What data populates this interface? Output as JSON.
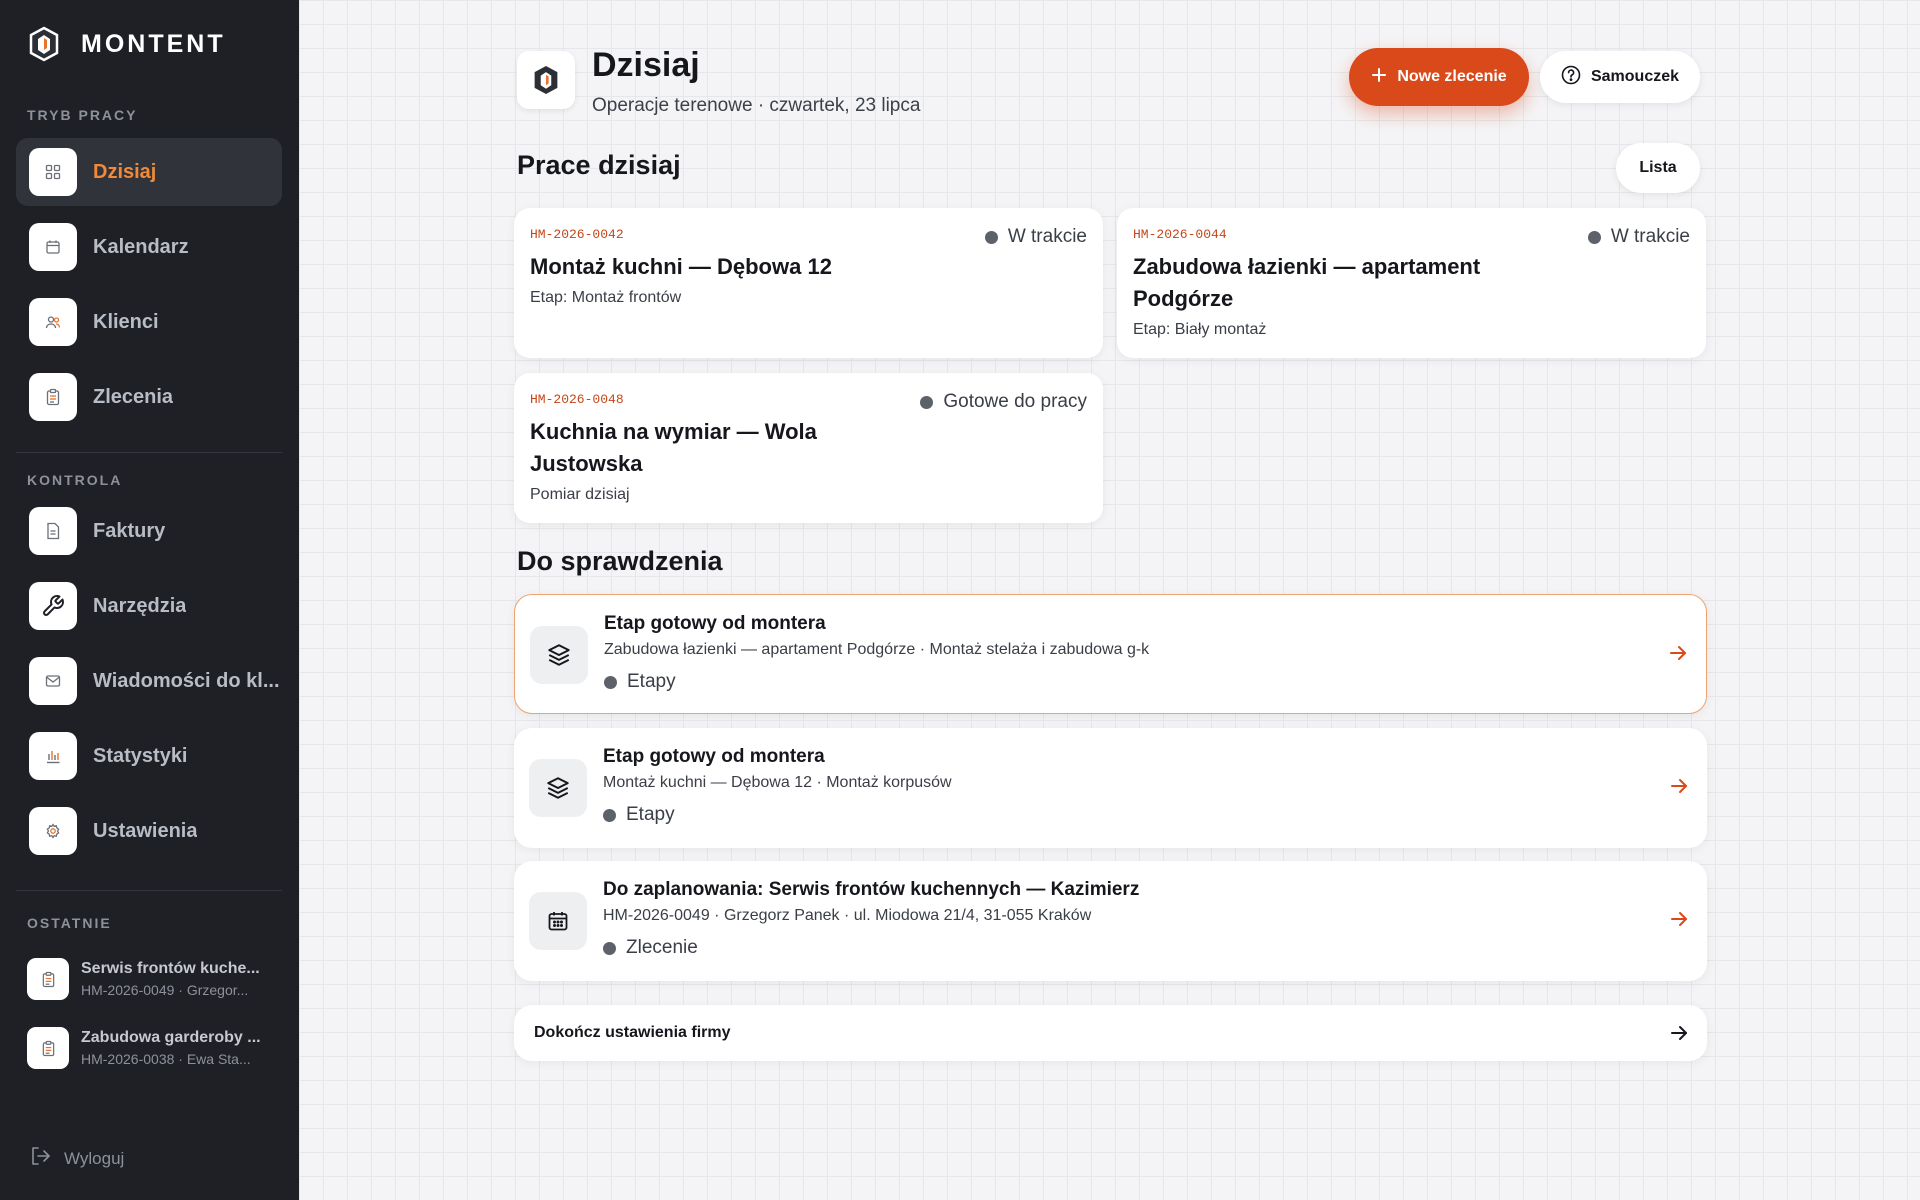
{
  "brand": {
    "name": "MONTENT"
  },
  "sidebar": {
    "sections": {
      "work": "TRYB PRACY",
      "control": "KONTROLA",
      "recent": "OSTATNIE"
    },
    "work_items": [
      {
        "label": "Dzisiaj",
        "icon": "grid-icon",
        "active": true
      },
      {
        "label": "Kalendarz",
        "icon": "calendar-icon"
      },
      {
        "label": "Klienci",
        "icon": "users-icon"
      },
      {
        "label": "Zlecenia",
        "icon": "clipboard-icon"
      }
    ],
    "control_items": [
      {
        "label": "Faktury",
        "icon": "document-icon"
      },
      {
        "label": "Narzędzia",
        "icon": "wrench-icon"
      },
      {
        "label": "Wiadomości do kl...",
        "icon": "mail-icon"
      },
      {
        "label": "Statystyki",
        "icon": "bar-chart-icon"
      },
      {
        "label": "Ustawienia",
        "icon": "gear-icon"
      }
    ],
    "recent_items": [
      {
        "title": "Serwis frontów kuche...",
        "sub": "HM-2026-0049 · Grzegor..."
      },
      {
        "title": "Zabudowa garderoby ...",
        "sub": "HM-2026-0038 · Ewa Sta..."
      }
    ],
    "logout": "Wyloguj"
  },
  "header": {
    "title": "Dzisiaj",
    "subtitle": "Operacje terenowe · czwartek, 23 lipca",
    "primary_button": "Nowe zlecenie",
    "secondary_button": "Samouczek"
  },
  "today": {
    "title": "Prace dzisiaj",
    "view_button": "Lista",
    "jobs": [
      {
        "code": "HM-2026-0042",
        "status": "W trakcie",
        "title": "Montaż kuchni — Dębowa 12",
        "stage": "Etap: Montaż frontów"
      },
      {
        "code": "HM-2026-0044",
        "status": "W trakcie",
        "title": "Zabudowa łazienki — apartament Podgórze",
        "stage": "Etap: Biały montaż"
      },
      {
        "code": "HM-2026-0048",
        "status": "Gotowe do pracy",
        "title": "Kuchnia na wymiar — Wola Justowska",
        "stage": "Pomiar dzisiaj"
      }
    ]
  },
  "review": {
    "title": "Do sprawdzenia",
    "items": [
      {
        "title": "Etap gotowy od montera",
        "sub": "Zabudowa łazienki — apartament Podgórze · Montaż stelaża i zabudowa g-k",
        "tag": "Etapy",
        "icon": "layers-icon"
      },
      {
        "title": "Etap gotowy od montera",
        "sub": "Montaż kuchni — Dębowa 12 · Montaż korpusów",
        "tag": "Etapy",
        "icon": "layers-icon"
      },
      {
        "title": "Do zaplanowania: Serwis frontów kuchennych — Kazimierz",
        "sub": "HM-2026-0049 · Grzegorz Panek · ul. Miodowa 21/4, 31-055 Kraków",
        "tag": "Zlecenie",
        "icon": "calendar-icon"
      }
    ],
    "setup": "Dokończ ustawienia firmy"
  },
  "colors": {
    "accent": "#d9491a",
    "active_nav": "#f08a3a",
    "sidebar_bg": "#1e2026",
    "code": "#c4461a"
  }
}
